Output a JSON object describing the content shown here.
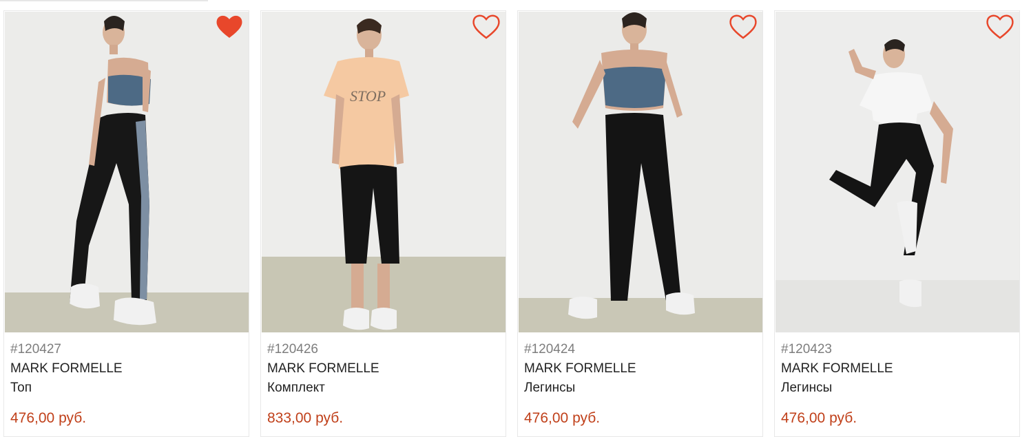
{
  "colors": {
    "price": "#c0401a",
    "favorite_active": "#e8472b",
    "favorite_outline": "#e8472b"
  },
  "products": [
    {
      "article": "#120427",
      "brand": "MARK FORMELLE",
      "type": "Топ",
      "price": "476,00 руб.",
      "favorite": true,
      "favorite_icon": "heart-filled-icon"
    },
    {
      "article": "#120426",
      "brand": "MARK FORMELLE",
      "type": "Комплект",
      "price": "833,00 руб.",
      "favorite": false,
      "favorite_icon": "heart-outline-icon"
    },
    {
      "article": "#120424",
      "brand": "MARK FORMELLE",
      "type": "Легинсы",
      "price": "476,00 руб.",
      "favorite": false,
      "favorite_icon": "heart-outline-icon"
    },
    {
      "article": "#120423",
      "brand": "MARK FORMELLE",
      "type": "Легинсы",
      "price": "476,00 руб.",
      "favorite": false,
      "favorite_icon": "heart-outline-icon"
    }
  ]
}
